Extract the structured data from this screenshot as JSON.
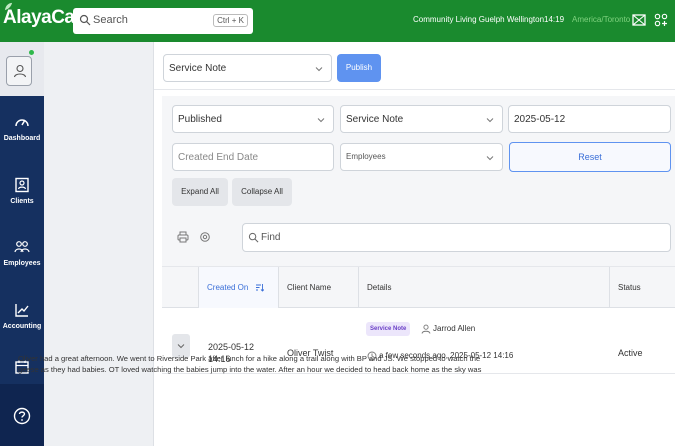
{
  "app": {
    "logo": "AlayaCare",
    "search_label": "Search",
    "search_shortcut": "Ctrl + K",
    "organization": "Community Living Guelph Wellington",
    "time": "14:19",
    "timezone": "America/Toronto"
  },
  "nav": {
    "items": [
      {
        "label": "Dashboard",
        "icon": "gauge-icon"
      },
      {
        "label": "Clients",
        "icon": "client-card-icon"
      },
      {
        "label": "Employees",
        "icon": "employees-icon"
      },
      {
        "label": "Accounting",
        "icon": "chart-icon"
      }
    ]
  },
  "toolbar": {
    "note_type": "Service Note",
    "publish_label": "Publish"
  },
  "filters": {
    "status": "Published",
    "note_type": "Service Note",
    "created_start": "2025-05-12",
    "created_end_placeholder": "Created End Date",
    "employees_placeholder": "Employees",
    "reset_label": "Reset",
    "expand_all": "Expand All",
    "collapse_all": "Collapse All",
    "find_placeholder": "Find"
  },
  "table": {
    "columns": [
      "Created On",
      "Client Name",
      "Details",
      "Status"
    ],
    "rows": [
      {
        "created_date": "2025-05-12",
        "created_time": "14:16",
        "client": "Oliver Twist",
        "badge": "Service Note",
        "author": "Jarrod Allen",
        "timestamp": "a few seconds ago, 2025-05-12 14:16",
        "status": "Active"
      }
    ],
    "narrative_line1": "Oliver had a great afternoon. We went to Riverside Park after lunch for a hike along a trail along with BP and JS. We stopped to watch the",
    "narrative_line2": "geese as they had babies. OT loved watching the babies jump into the water. After an hour we decided to head back home as the sky was"
  },
  "colors": {
    "topbar": "#1a8a2e",
    "sidenav": "#153060",
    "accent": "#5f93f0",
    "badge_bg": "#ece6fb",
    "badge_fg": "#6a3fc6"
  }
}
